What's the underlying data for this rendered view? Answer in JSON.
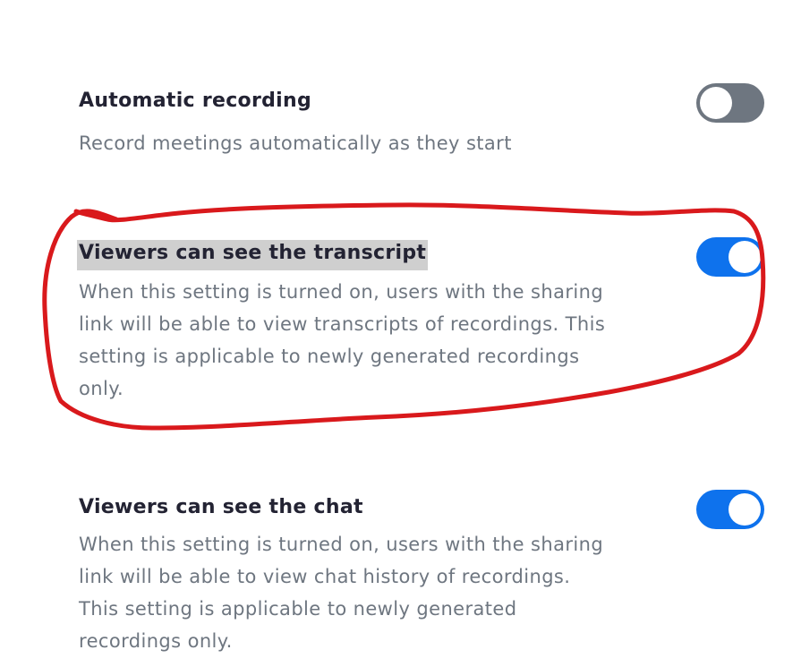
{
  "settings": [
    {
      "title": "Automatic recording",
      "description": "Record meetings automatically as they start",
      "enabled": false
    },
    {
      "title": "Viewers can see the transcript",
      "description": "When this setting is turned on, users with the sharing link will be able to view transcripts of recordings. This setting is applicable to newly generated recordings only.",
      "enabled": true
    },
    {
      "title": "Viewers can see the chat",
      "description": "When this setting is turned on, users with the sharing link will be able to view chat history of recordings. This setting is applicable to newly generated recordings only.",
      "enabled": true
    }
  ],
  "colors": {
    "toggle_on": "#0e72ed",
    "toggle_off": "#6e7680",
    "annotation_stroke": "#d9191c",
    "title_highlight": "#cfcfcf"
  },
  "icons": {
    "annotation": "red-hand-drawn-circle"
  }
}
